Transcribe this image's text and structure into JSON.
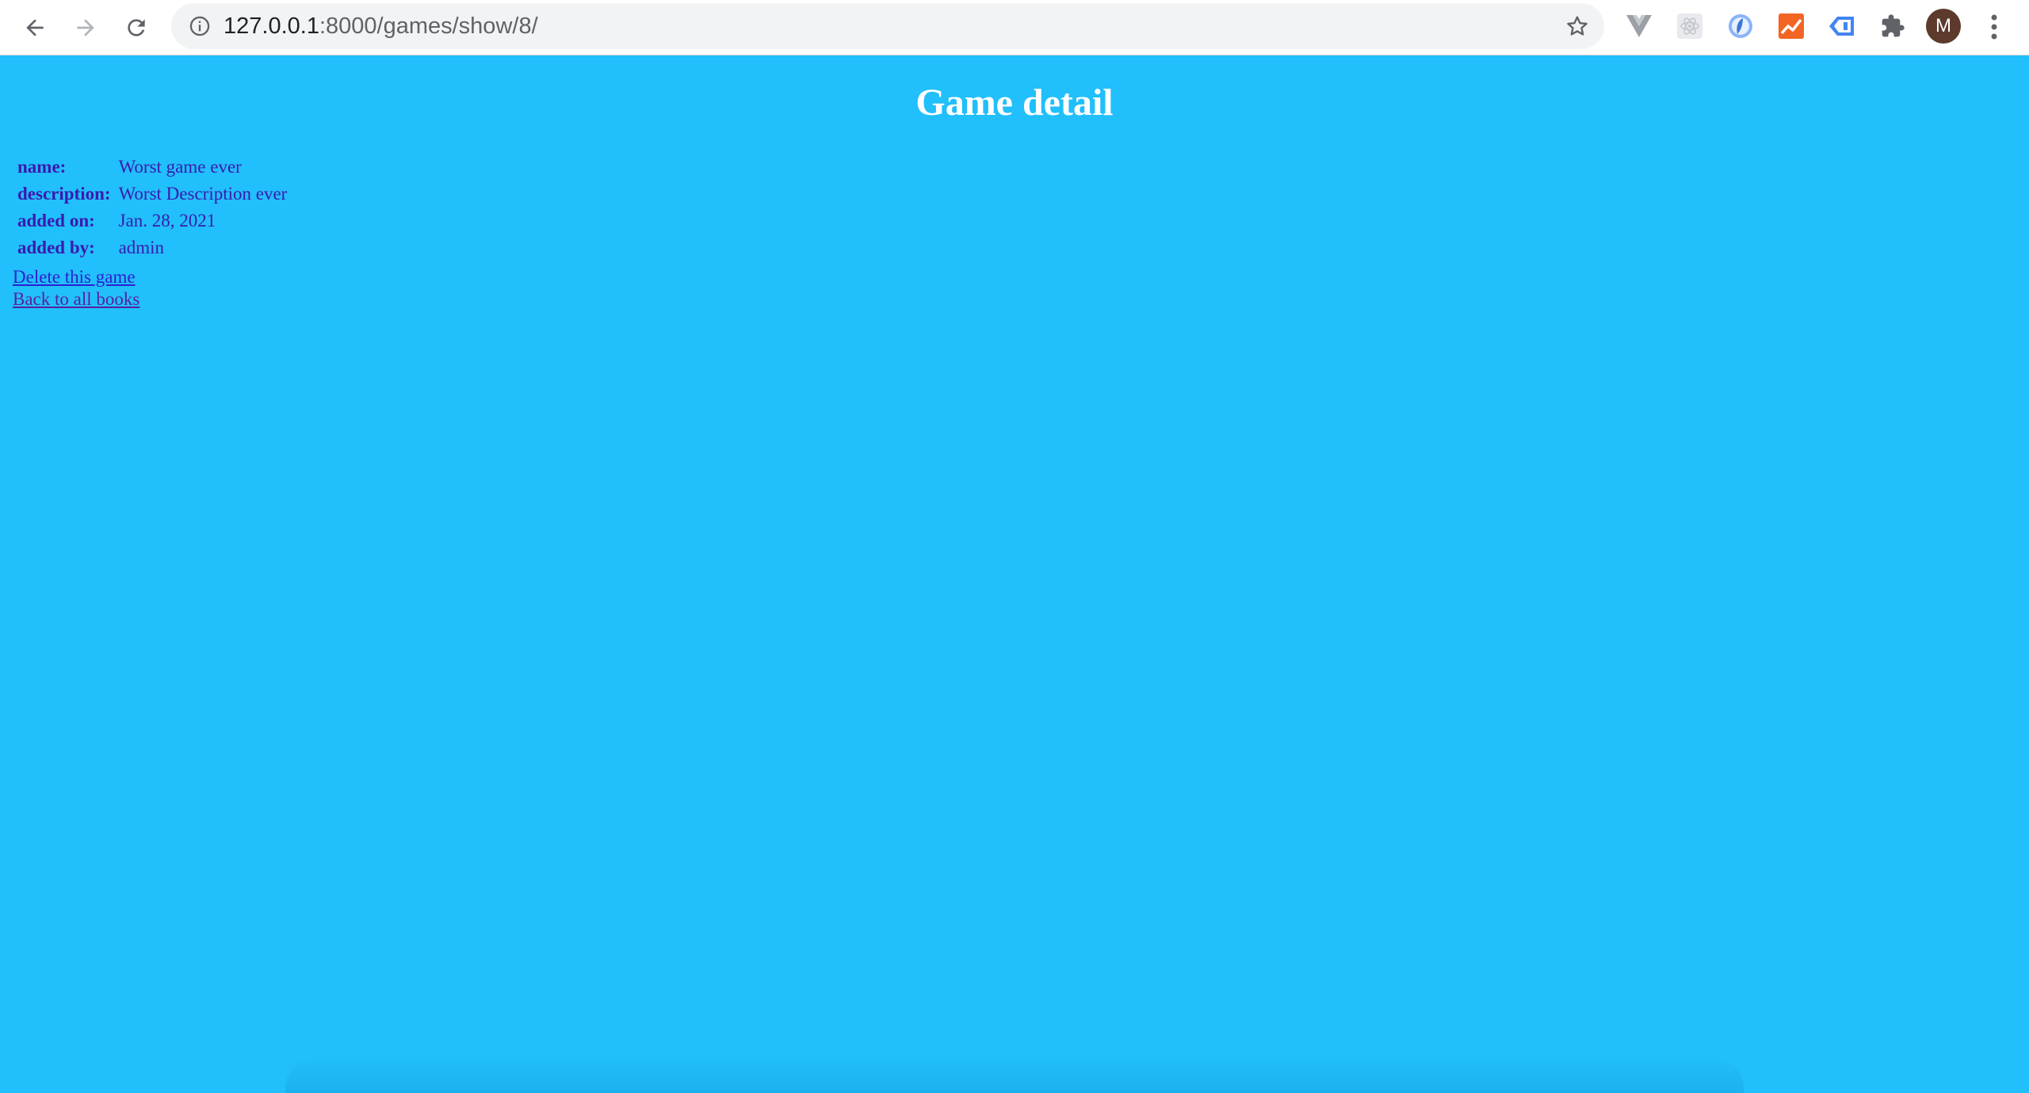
{
  "browser": {
    "url_host": "127.0.0.1",
    "url_path": ":8000/games/show/8/",
    "avatar_initial": "M",
    "icons": {
      "back": "arrow-left-icon",
      "forward": "arrow-right-icon",
      "reload": "reload-icon",
      "info": "info-icon",
      "bookmark": "star-icon",
      "extensions": [
        "vue-devtools-icon",
        "react-devtools-icon",
        "ext-blue-circle-icon",
        "ext-analytics-icon",
        "ext-tag-icon",
        "puzzle-icon"
      ],
      "menu": "more-vert-icon"
    }
  },
  "page": {
    "title": "Game detail",
    "details": [
      {
        "label": "name:",
        "value": "Worst game ever"
      },
      {
        "label": "description:",
        "value": "Worst Description ever"
      },
      {
        "label": "added on:",
        "value": "Jan. 28, 2021"
      },
      {
        "label": "added by:",
        "value": "admin"
      }
    ],
    "links": {
      "delete": "Delete this game",
      "back": "Back to all books"
    }
  },
  "colors": {
    "background": "#21bffb",
    "title": "#ffffff",
    "table_text": "#3a1ab0",
    "link": "#2e1fd0"
  }
}
